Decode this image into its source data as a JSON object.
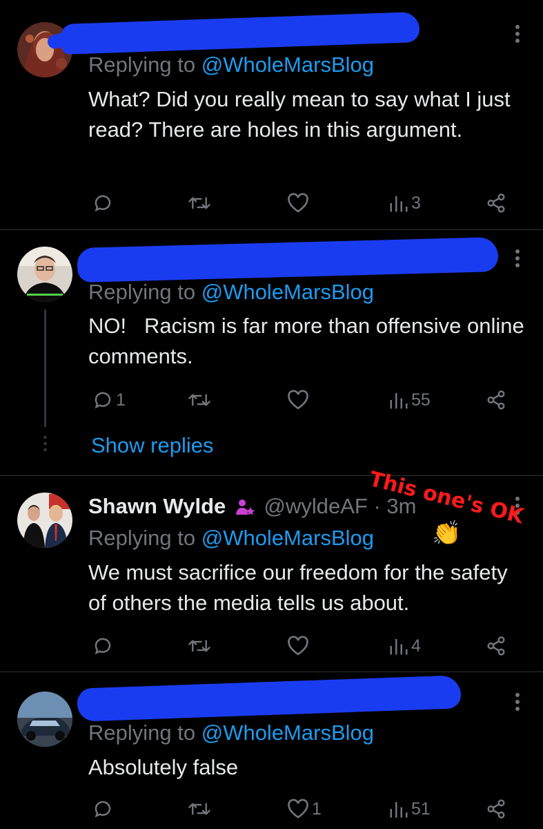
{
  "colors": {
    "background": "#000000",
    "text": "#e7e9ea",
    "muted": "#71767b",
    "link": "#1d9bf0",
    "divider": "#2f3336",
    "scribble": "#1a3cf0",
    "annotation": "#ff1a1a",
    "verified_badge": "#1d9bf0",
    "subscriber_icon": "#c940d3"
  },
  "replying_prefix": "Replying to ",
  "replying_mention": "@WholeMarsBlog",
  "tweets": [
    {
      "name": "",
      "handle": "",
      "time": "",
      "body": "What? Did you really mean to say what I just read? There are holes in this argument.",
      "replies": "",
      "retweets": "",
      "likes": "",
      "views": "3"
    },
    {
      "name": "",
      "handle": "",
      "time": "",
      "body": "NO!   Racism is far more than offensive online comments.",
      "replies": "1",
      "retweets": "",
      "likes": "",
      "views": "55",
      "show_replies": "Show replies"
    },
    {
      "name": "Shawn Wylde",
      "handle": "@wyldeAF",
      "separator": " · ",
      "time": "3m",
      "body": "We must sacrifice our freedom for the safety of others the media tells us about.",
      "replies": "",
      "retweets": "",
      "likes": "",
      "views": "4"
    },
    {
      "name": "",
      "handle": "",
      "time": "",
      "body": "Absolutely false",
      "replies": "",
      "retweets": "",
      "likes": "1",
      "views": "51"
    }
  ],
  "annotation": {
    "text": "This one's OK",
    "emoji": "👏"
  },
  "icons": {
    "reply": "speech-bubble-icon",
    "retweet": "retweet-arrows-icon",
    "like": "heart-icon",
    "views": "bar-chart-icon",
    "share": "share-nodes-icon",
    "more": "vertical-ellipsis-icon",
    "subscriber": "person-star-icon"
  }
}
